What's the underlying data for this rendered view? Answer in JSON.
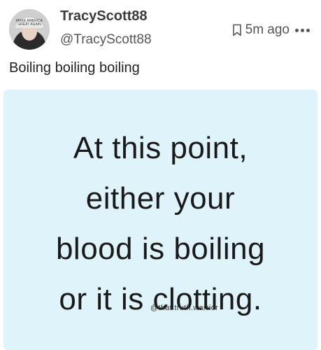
{
  "post": {
    "author": {
      "display_name": "TracyScott88",
      "handle": "@TracyScott88",
      "avatar_icon": "avatar-photo"
    },
    "timestamp": "5m ago",
    "bookmark_icon": "bookmark-icon",
    "more_icon": "more-options-icon",
    "text": "Boiling boiling boiling",
    "media": {
      "background_color": "#dff3fb",
      "quote_lines": [
        "At this point,",
        "either your",
        "blood is boiling",
        "or it is clotting."
      ],
      "watermark": "@that.truth.warrior"
    }
  }
}
